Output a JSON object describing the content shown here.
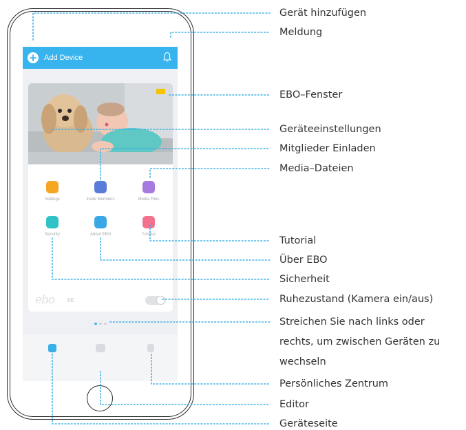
{
  "app": {
    "add_device_label": "Add Device",
    "header_color": "#37b3ee"
  },
  "grid": [
    {
      "label": "Settings",
      "icon": "settings-icon",
      "color": "#f5a623"
    },
    {
      "label": "Invite Members",
      "icon": "invite-members-icon",
      "color": "#5b7bd8"
    },
    {
      "label": "Media Files",
      "icon": "media-files-icon",
      "color": "#a57be0"
    },
    {
      "label": "Security",
      "icon": "security-icon",
      "color": "#2fc3c7"
    },
    {
      "label": "About EBO",
      "icon": "about-ebo-icon",
      "color": "#3aa7e6"
    },
    {
      "label": "Tutorial",
      "icon": "tutorial-icon",
      "color": "#f2718d"
    }
  ],
  "device": {
    "logo_text": "ebo",
    "model": "SE"
  },
  "callouts": {
    "add_device": "Gerät hinzufügen",
    "notification": "Meldung",
    "ebo_window": "EBO–Fenster",
    "device_settings": "Geräteeinstellungen",
    "invite_members": "Mitglieder Einladen",
    "media_files": "Media–Dateien",
    "tutorial": "Tutorial",
    "about_ebo": "Über EBO",
    "security": "Sicherheit",
    "sleep_mode": "Ruhezustand (Kamera ein/aus)",
    "swipe_line1": "Streichen Sie nach links oder",
    "swipe_line2": "rechts, um zwischen Geräten zu",
    "swipe_line3": "wechseln",
    "personal_center": "Persönliches Zentrum",
    "editor": "Editor",
    "device_page": "Geräteseite"
  },
  "colors": {
    "leader": "#3bb0e6",
    "text": "#333333"
  }
}
